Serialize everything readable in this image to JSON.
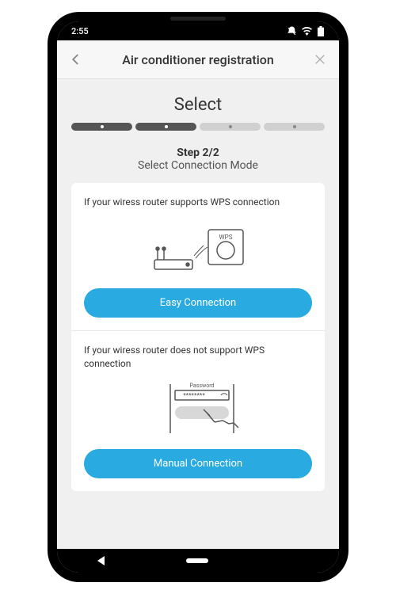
{
  "status": {
    "time": "2:55"
  },
  "header": {
    "title": "Air conditioner registration"
  },
  "section_title": "Select",
  "step": {
    "label": "Step 2/2",
    "subtitle": "Select Connection Mode"
  },
  "options": {
    "easy": {
      "description": "If your wiress router supports WPS connection",
      "button": "Easy Connection",
      "wps_label": "WPS"
    },
    "manual": {
      "description": "If your wiress router does not support WPS connection",
      "button": "Manual Connection",
      "password_label": "Password",
      "password_mask": "********"
    }
  }
}
